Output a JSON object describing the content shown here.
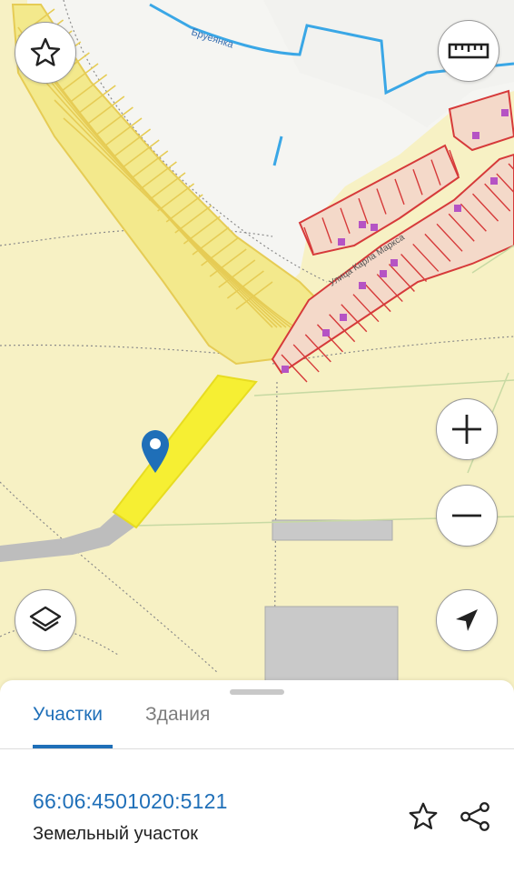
{
  "map": {
    "labels": {
      "river": "Бруеянка",
      "street": "Улица Карла Маркса"
    },
    "colors": {
      "land": "#f7f1c4",
      "plot_fill": "#f3e98c",
      "plot_line": "#e6cc55",
      "residential_fill": "#f4d9c9",
      "residential_line": "#d63a3a",
      "building": "#b553c4",
      "selected_parcel": "#f6ef33",
      "road": "#bdbdbd",
      "water": "#3aa7e6",
      "marker": "#1f6fb8"
    }
  },
  "controls": {
    "favorite_icon": "star-icon",
    "ruler_icon": "ruler-icon",
    "zoom_in_icon": "plus-icon",
    "zoom_out_icon": "minus-icon",
    "layers_icon": "layers-icon",
    "locate_icon": "navigation-arrow-icon"
  },
  "sheet": {
    "tabs": [
      {
        "label": "Участки",
        "active": true
      },
      {
        "label": "Здания",
        "active": false
      }
    ],
    "parcel": {
      "cadastral_number": "66:06:4501020:5121",
      "type": "Земельный участок"
    }
  }
}
